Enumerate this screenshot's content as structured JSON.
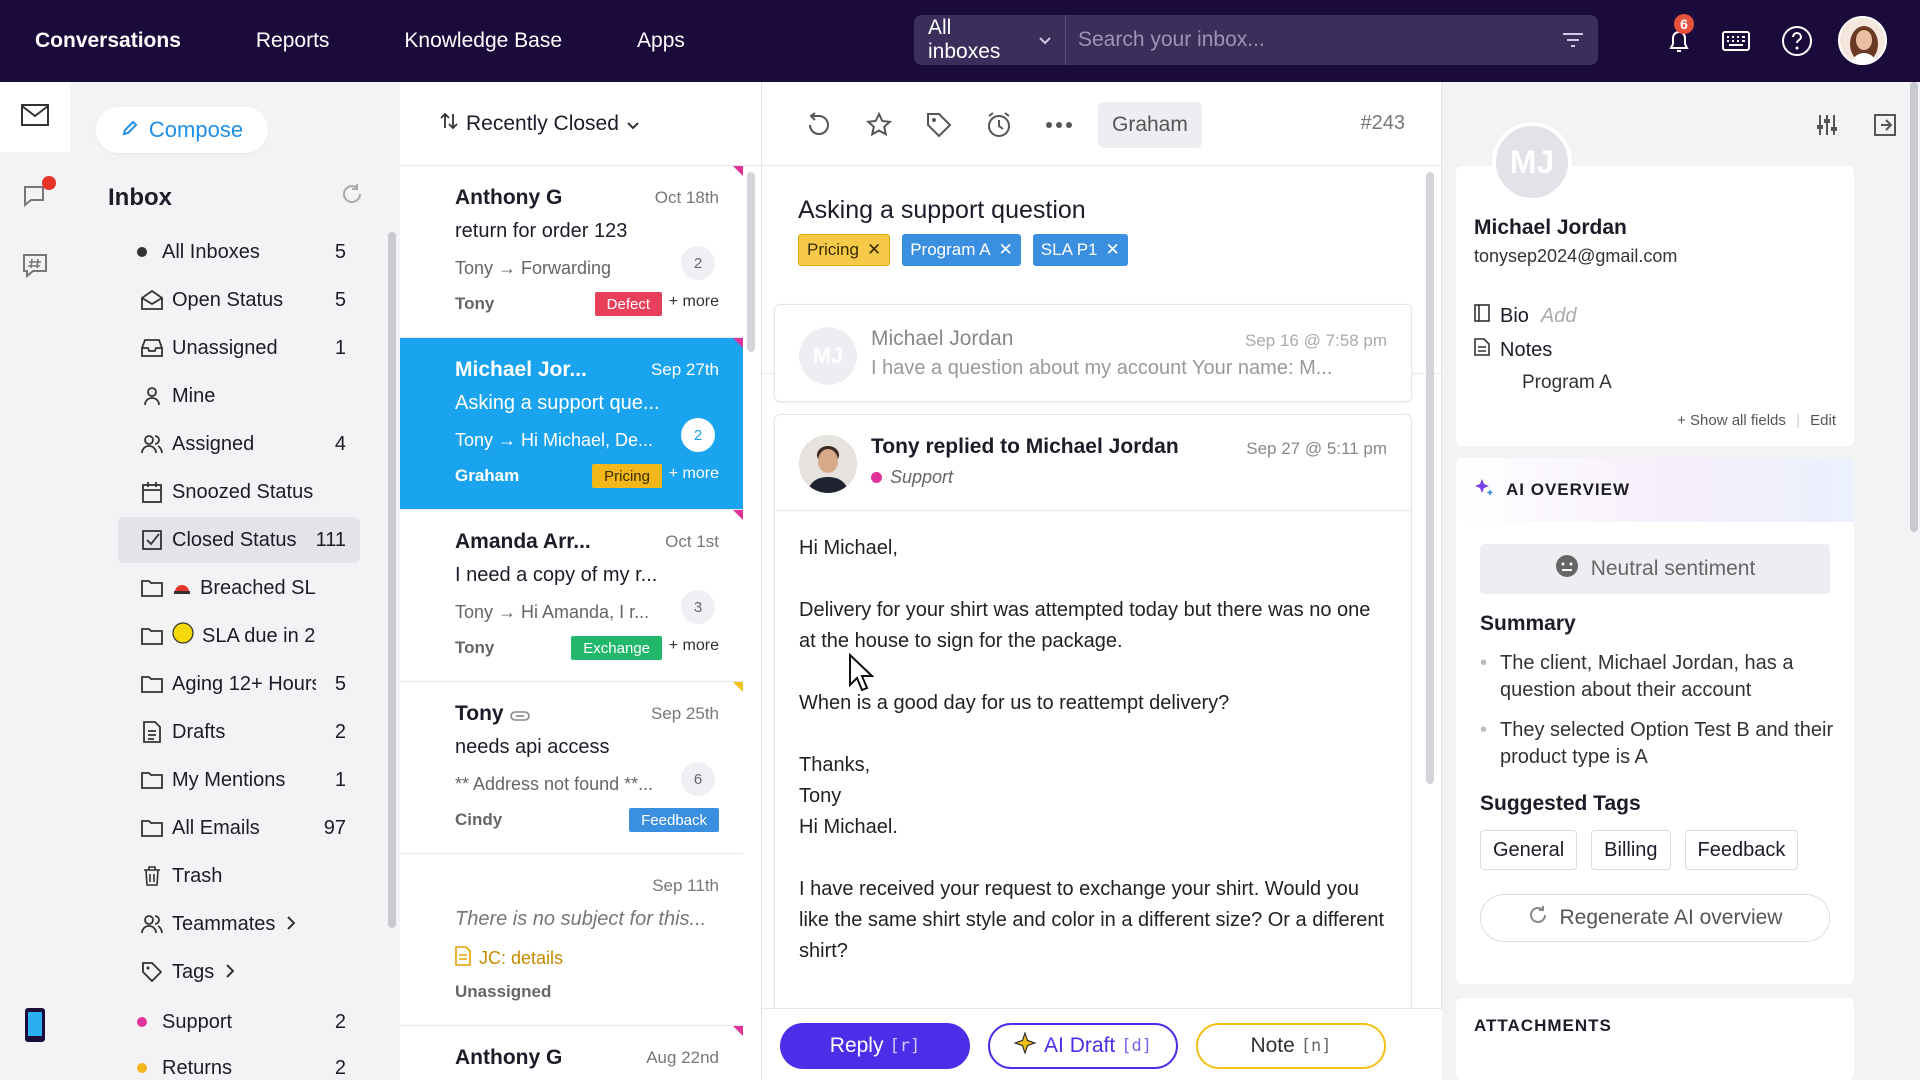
{
  "topnav": {
    "items": [
      "Conversations",
      "Reports",
      "Knowledge Base",
      "Apps"
    ],
    "inbox_select": "All inboxes",
    "search_placeholder": "Search your inbox...",
    "notification_count": "6"
  },
  "sidebar": {
    "compose": "Compose",
    "title": "Inbox",
    "items": [
      {
        "label": "All Inboxes",
        "count": "5",
        "icon": "dot-icon"
      },
      {
        "label": "Open Status",
        "count": "5",
        "icon": "envelope-open-icon"
      },
      {
        "label": "Unassigned",
        "count": "1",
        "icon": "inbox-tray-icon"
      },
      {
        "label": "Mine",
        "count": "",
        "icon": "user-icon"
      },
      {
        "label": "Assigned",
        "count": "4",
        "icon": "users-icon"
      },
      {
        "label": "Snoozed Status",
        "count": "",
        "icon": "calendar-icon"
      },
      {
        "label": "Closed Status",
        "count": "111",
        "icon": "check-square-icon"
      },
      {
        "label": "Breached SLA",
        "count": "",
        "icon": "folder-icon"
      },
      {
        "label": "SLA due in 2...",
        "count": "",
        "icon": "folder-icon"
      },
      {
        "label": "Aging 12+ Hours",
        "count": "5",
        "icon": "folder-icon"
      },
      {
        "label": "Drafts",
        "count": "2",
        "icon": "document-icon"
      },
      {
        "label": "My Mentions",
        "count": "1",
        "icon": "folder-icon"
      },
      {
        "label": "All Emails",
        "count": "97",
        "icon": "folder-icon"
      },
      {
        "label": "Trash",
        "count": "",
        "icon": "trash-icon"
      },
      {
        "label": "Teammates",
        "count": "",
        "icon": "users-icon"
      },
      {
        "label": "Tags",
        "count": "",
        "icon": "tag-icon"
      },
      {
        "label": "Support",
        "count": "2",
        "icon": "dot-icon"
      },
      {
        "label": "Returns",
        "count": "2",
        "icon": "dot-icon"
      }
    ],
    "colors": {
      "support": "#e0339a",
      "returns": "#f2b71a",
      "all_inboxes": "#333333"
    }
  },
  "convlist": {
    "sort_label": "Recently Closed",
    "conversations": [
      {
        "name": "Anthony G",
        "date": "Oct 18th",
        "subject": "return for order 123",
        "preview": "Tony → Forwarding",
        "count": "2",
        "assignee": "Tony",
        "tag": "Defect",
        "tag_color": "#e8405a",
        "more": "+ more"
      },
      {
        "name": "Michael Jor...",
        "date": "Sep 27th",
        "subject": "Asking a support que...",
        "preview": "Tony → Hi Michael,   De...",
        "count": "2",
        "assignee": "Graham",
        "tag": "Pricing",
        "tag_color": "#f2b71a",
        "more": "+ more"
      },
      {
        "name": "Amanda Arr...",
        "date": "Oct 1st",
        "subject": "I need a copy of my r...",
        "preview": "Tony → Hi Amanda,   I r...",
        "count": "3",
        "assignee": "Tony",
        "tag": "Exchange",
        "tag_color": "#21b86b",
        "more": "+ more"
      },
      {
        "name": "Tony",
        "date": "Sep 25th",
        "subject": "needs api access",
        "preview": "** Address not found **...",
        "count": "6",
        "assignee": "Cindy",
        "tag": "Feedback",
        "tag_color": "#3b8fe0",
        "more": ""
      },
      {
        "name": "",
        "date": "Sep 11th",
        "subject": "There is no subject for this...",
        "preview": "JC: details",
        "count": "",
        "assignee": "Unassigned",
        "tag": "",
        "tag_color": "",
        "more": ""
      },
      {
        "name": "Anthony G",
        "date": "Aug 22nd",
        "subject": "",
        "preview": "",
        "count": "",
        "assignee": "",
        "tag": "",
        "tag_color": "",
        "more": ""
      }
    ]
  },
  "message": {
    "assignee": "Graham",
    "number": "#243",
    "subject": "Asking a support question",
    "tags": [
      {
        "label": "Pricing",
        "bg": "#f7c948",
        "fg": "#3a2c00"
      },
      {
        "label": "Program A",
        "bg": "#3b8fe0",
        "fg": "#ffffff"
      },
      {
        "label": "SLA P1",
        "bg": "#3b8fe0",
        "fg": "#ffffff"
      }
    ],
    "collapsed": {
      "initials": "MJ",
      "from": "Michael Jordan",
      "date": "Sep 16 @ 7:58 pm",
      "snippet": "I have a question about my account Your name: M..."
    },
    "expanded": {
      "from": "Tony replied to Michael Jordan",
      "date": "Sep 27 @ 5:11 pm",
      "channel": "Support",
      "greeting": "Hi Michael,",
      "p1": "Delivery for your shirt was attempted today but there was no one at the house to sign for the package.",
      "p2": "When is a good day for us to reattempt delivery?",
      "signoff1": "Thanks,",
      "signoff2": "Tony",
      "greeting2": "Hi Michael.",
      "p3": "I have received your request to exchange your shirt. Would you like the same shirt style and color in a different size? Or a different shirt?"
    },
    "reply": {
      "label": "Reply",
      "shortcut": "[r]"
    },
    "ai_draft": {
      "label": "AI Draft",
      "shortcut": "[d]"
    },
    "note": {
      "label": "Note",
      "shortcut": "[n]"
    }
  },
  "contact": {
    "initials": "MJ",
    "name": "Michael Jordan",
    "email": "tonysep2024@gmail.com",
    "bio_label": "Bio",
    "bio_add": "Add",
    "notes_label": "Notes",
    "notes_value": "Program A",
    "show_all": "+ Show all fields",
    "edit": "Edit"
  },
  "ai_overview": {
    "title": "AI OVERVIEW",
    "sentiment": "Neutral sentiment",
    "summary_title": "Summary",
    "summary": [
      "The client, Michael Jordan, has a question about their account",
      "They selected Option Test B and their product type is A"
    ],
    "suggested_title": "Suggested Tags",
    "suggested_tags": [
      "General",
      "Billing",
      "Feedback"
    ],
    "regenerate": "Regenerate AI overview"
  },
  "attachments": {
    "title": "ATTACHMENTS"
  }
}
